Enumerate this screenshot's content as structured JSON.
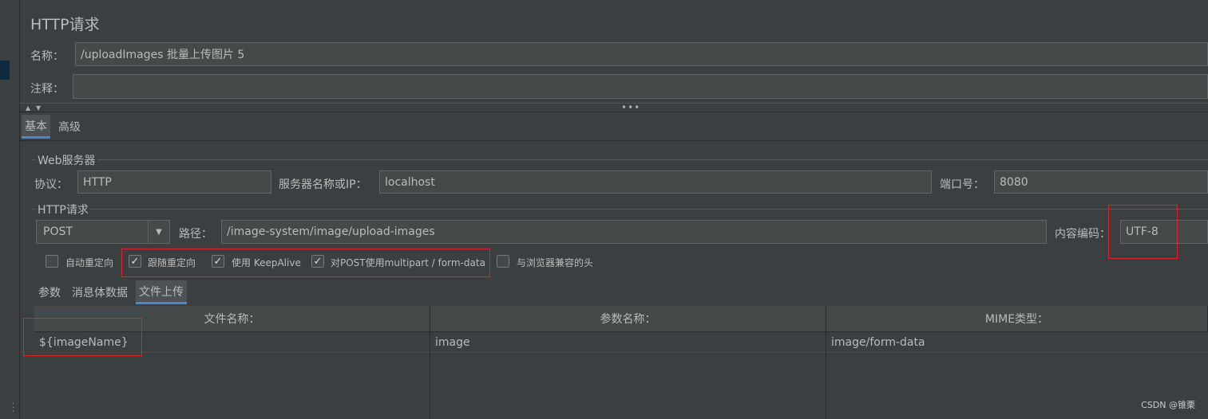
{
  "title": "HTTP请求",
  "name": {
    "label": "名称：",
    "value": "/uploadImages 批量上传图片 5"
  },
  "comment": {
    "label": "注释：",
    "value": ""
  },
  "splitter": {
    "dots": "•••"
  },
  "main_tabs": [
    "基本",
    "高级"
  ],
  "web_server": {
    "group": "Web服务器",
    "protocol_label": "协议：",
    "protocol": "HTTP",
    "server_label": "服务器名称或IP：",
    "server": "localhost",
    "port_label": "端口号：",
    "port": "8080"
  },
  "http_request": {
    "group": "HTTP请求",
    "method": "POST",
    "path_label": "路径：",
    "path": "/image-system/image/upload-images",
    "encoding_label": "内容编码：",
    "encoding": "UTF-8"
  },
  "options": [
    {
      "label": "自动重定向",
      "checked": false
    },
    {
      "label": "跟随重定向",
      "checked": true
    },
    {
      "label": "使用 KeepAlive",
      "checked": true
    },
    {
      "label": "对POST使用multipart / form-data",
      "checked": true
    },
    {
      "label": "与浏览器兼容的头",
      "checked": false
    }
  ],
  "sub_tabs": [
    "参数",
    "消息体数据",
    "文件上传"
  ],
  "table": {
    "columns": [
      "文件名称：",
      "参数名称：",
      "MIME类型："
    ],
    "rows": [
      [
        "${imageName}",
        "image",
        "image/form-data"
      ]
    ]
  },
  "watermark": "CSDN @锥栗",
  "colors": {
    "highlight": "#e0242a",
    "active_tab": "#4a88c7"
  }
}
